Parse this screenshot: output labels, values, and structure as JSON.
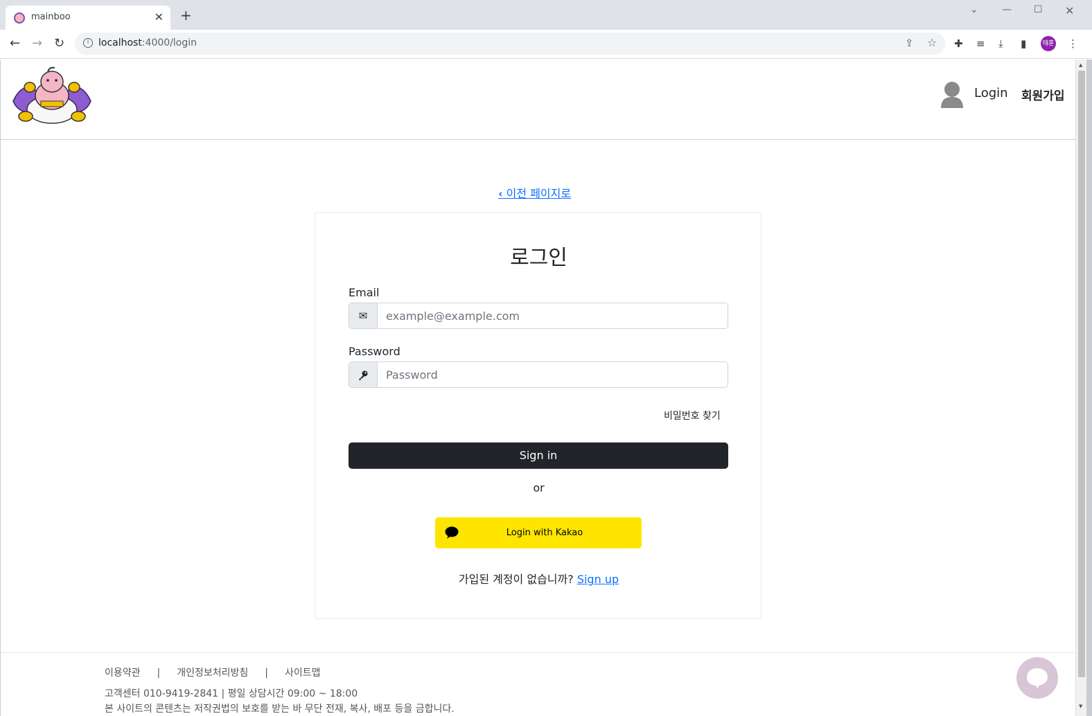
{
  "browser": {
    "tab_title": "mainboo",
    "tab_close": "✕",
    "new_tab": "+",
    "url_host": "localhost",
    "url_path": ":4000/login",
    "profile_initial": "태훈",
    "icons": [
      "back-icon",
      "forward-icon",
      "reload-icon",
      "info-icon",
      "share-icon",
      "star-icon",
      "extensions-icon",
      "media-icon",
      "download-icon",
      "side-panel-icon",
      "menu-icon"
    ]
  },
  "header": {
    "login_label": "Login",
    "signup_label": "회원가입"
  },
  "back_link": {
    "chevron": "‹",
    "label": " 이전 페이지로"
  },
  "login_form": {
    "title": "로그인",
    "email_label": "Email",
    "email_placeholder": "example@example.com",
    "email_value": "",
    "password_label": "Password",
    "password_placeholder": "Password",
    "password_value": "",
    "find_password": "비밀번호 찾기",
    "signin_label": "Sign in",
    "or_text": "or",
    "kakao_label": "Login with Kakao",
    "kakao_color": "#fee500",
    "signup_prompt": "가입된 계정이 없습니까? ",
    "signup_link": "Sign up"
  },
  "footer": {
    "links": [
      "이용약관",
      "개인정보처리방침",
      "사이트맵"
    ],
    "separator": "|",
    "contact": "고객센터 010-9419-2841 | 평일 상담시간 09:00 ~ 18:00",
    "copyright": "본 사이트의 콘텐츠는 저작권법의 보호를 받는 바 무단 전재, 복사, 배포 등을 금합니다."
  },
  "colors": {
    "accent_link": "#0d6efd",
    "dark_button": "#212529",
    "chat_bubble": "#d8c6d8"
  }
}
